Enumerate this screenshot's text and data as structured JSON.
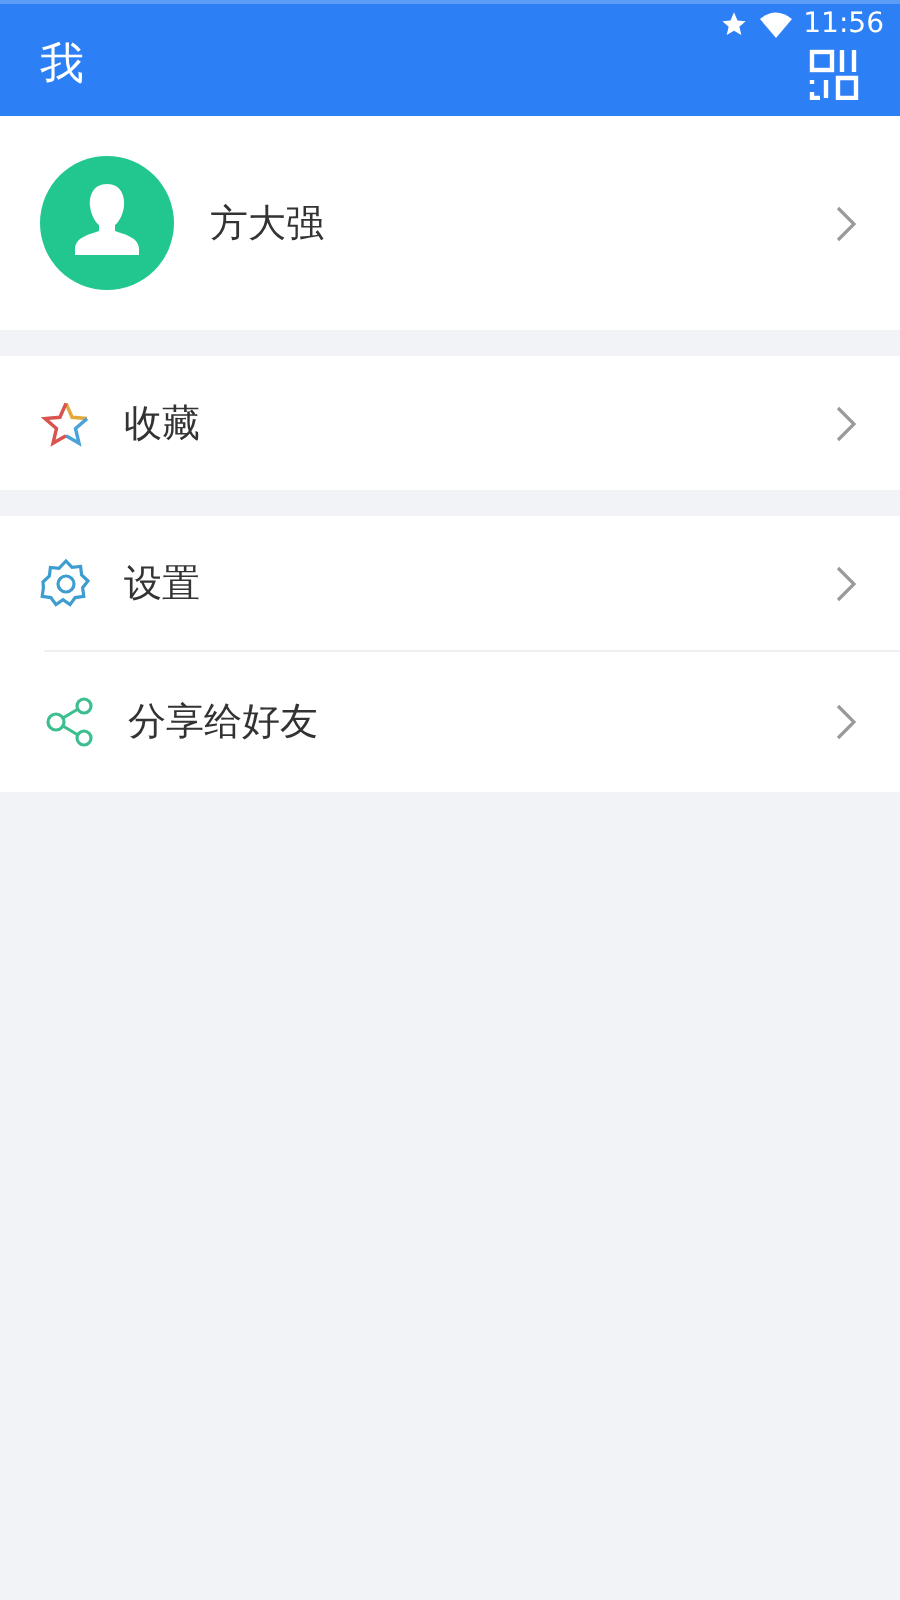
{
  "status_bar": {
    "time": "11:56"
  },
  "app_bar": {
    "title": "我"
  },
  "profile": {
    "name": "方大强"
  },
  "menu_groups": [
    {
      "items": [
        {
          "kind": "favorites",
          "label": "收藏"
        }
      ]
    },
    {
      "items": [
        {
          "kind": "settings",
          "label": "设置"
        },
        {
          "kind": "share",
          "label": "分享给好友"
        }
      ]
    }
  ]
}
